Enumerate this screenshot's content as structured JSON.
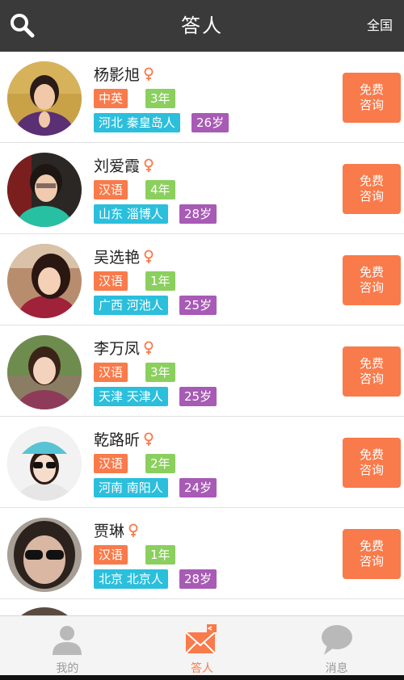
{
  "header": {
    "title": "答人",
    "region": "全国",
    "icon": "search-icon"
  },
  "consult_label_line1": "免费",
  "consult_label_line2": "咨询",
  "people": [
    {
      "name": "杨影旭",
      "language": "中英",
      "years": "3年",
      "location": "河北 秦皇岛人",
      "age": "26岁"
    },
    {
      "name": "刘爱霞",
      "language": "汉语",
      "years": "4年",
      "location": "山东 淄博人",
      "age": "28岁"
    },
    {
      "name": "吴选艳",
      "language": "汉语",
      "years": "1年",
      "location": "广西 河池人",
      "age": "25岁"
    },
    {
      "name": "李万凤",
      "language": "汉语",
      "years": "3年",
      "location": "天津 天津人",
      "age": "25岁"
    },
    {
      "name": "乾路昕",
      "language": "汉语",
      "years": "2年",
      "location": "河南 南阳人",
      "age": "24岁"
    },
    {
      "name": "贾琳",
      "language": "汉语",
      "years": "1年",
      "location": "北京 北京人",
      "age": "28岁"
    }
  ],
  "tabs": [
    {
      "label": "我的",
      "icon": "user-icon",
      "active": false
    },
    {
      "label": "答人",
      "icon": "mail-icon",
      "active": true
    },
    {
      "label": "消息",
      "icon": "chat-bubble-icon",
      "active": false
    }
  ],
  "colors": {
    "header_bg": "#3a3a3a",
    "accent": "#f97a4a",
    "year_tag": "#8bcf5e",
    "location_tag": "#2bbfdc",
    "age_tag": "#a75bb4"
  }
}
